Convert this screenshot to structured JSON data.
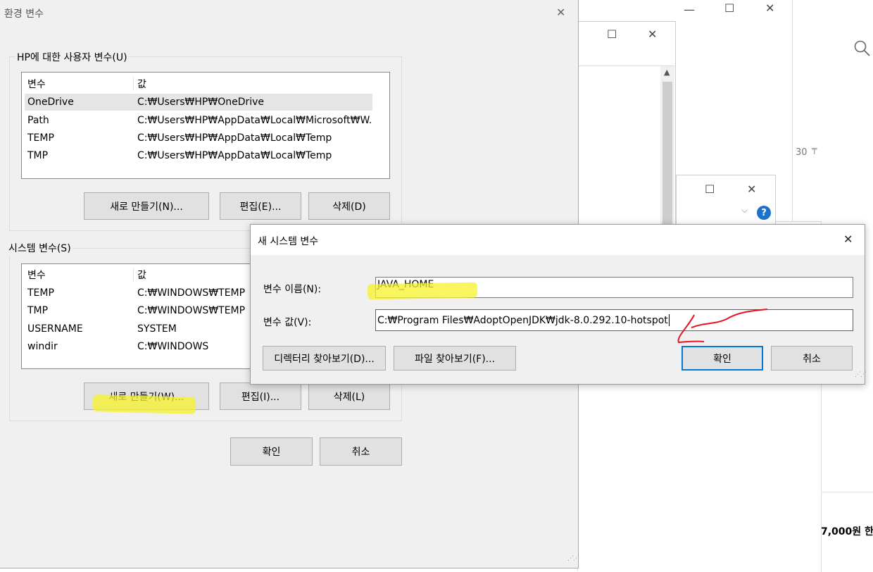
{
  "env_dialog": {
    "title": "환경 변수",
    "user_group_title": "HP에 대한 사용자 변수(U)",
    "user_table": {
      "headers": [
        "변수",
        "값"
      ],
      "rows": [
        [
          "OneDrive",
          "C:₩Users₩HP₩OneDrive"
        ],
        [
          "Path",
          "C:₩Users₩HP₩AppData₩Local₩Microsoft₩W..."
        ],
        [
          "TEMP",
          "C:₩Users₩HP₩AppData₩Local₩Temp"
        ],
        [
          "TMP",
          "C:₩Users₩HP₩AppData₩Local₩Temp"
        ]
      ]
    },
    "user_buttons": {
      "new": "새로 만들기(N)...",
      "edit": "편집(E)...",
      "delete": "삭제(D)"
    },
    "system_group_title": "시스템 변수(S)",
    "system_table": {
      "headers": [
        "변수",
        "값"
      ],
      "rows": [
        [
          "TEMP",
          "C:₩WINDOWS₩TEMP"
        ],
        [
          "TMP",
          "C:₩WINDOWS₩TEMP"
        ],
        [
          "USERNAME",
          "SYSTEM"
        ],
        [
          "windir",
          "C:₩WINDOWS"
        ]
      ]
    },
    "system_buttons": {
      "new": "새로 만들기(W)...",
      "edit": "편집(I)...",
      "delete": "삭제(L)"
    },
    "ok": "확인",
    "cancel": "취소"
  },
  "new_var_dialog": {
    "title": "새 시스템 변수",
    "name_label": "변수 이름(N):",
    "name_value": "JAVA_HOME",
    "value_label": "변수 값(V):",
    "value_value": "C:₩Program Files₩AdoptOpenJDK₩jdk-8.0.292.10-hotspot",
    "browse_dir": "디렉터리 찾아보기(D)...",
    "browse_file": "파일 찾아보기(F)...",
    "ok": "확인",
    "cancel": "취소"
  },
  "background": {
    "pin_count": "30",
    "price_text": "7,000원 한"
  },
  "colors": {
    "dialog_bg": "#f0f0f0",
    "accent": "#0078d7",
    "highlight": "#f5f22a",
    "annotation": "#e81123"
  }
}
